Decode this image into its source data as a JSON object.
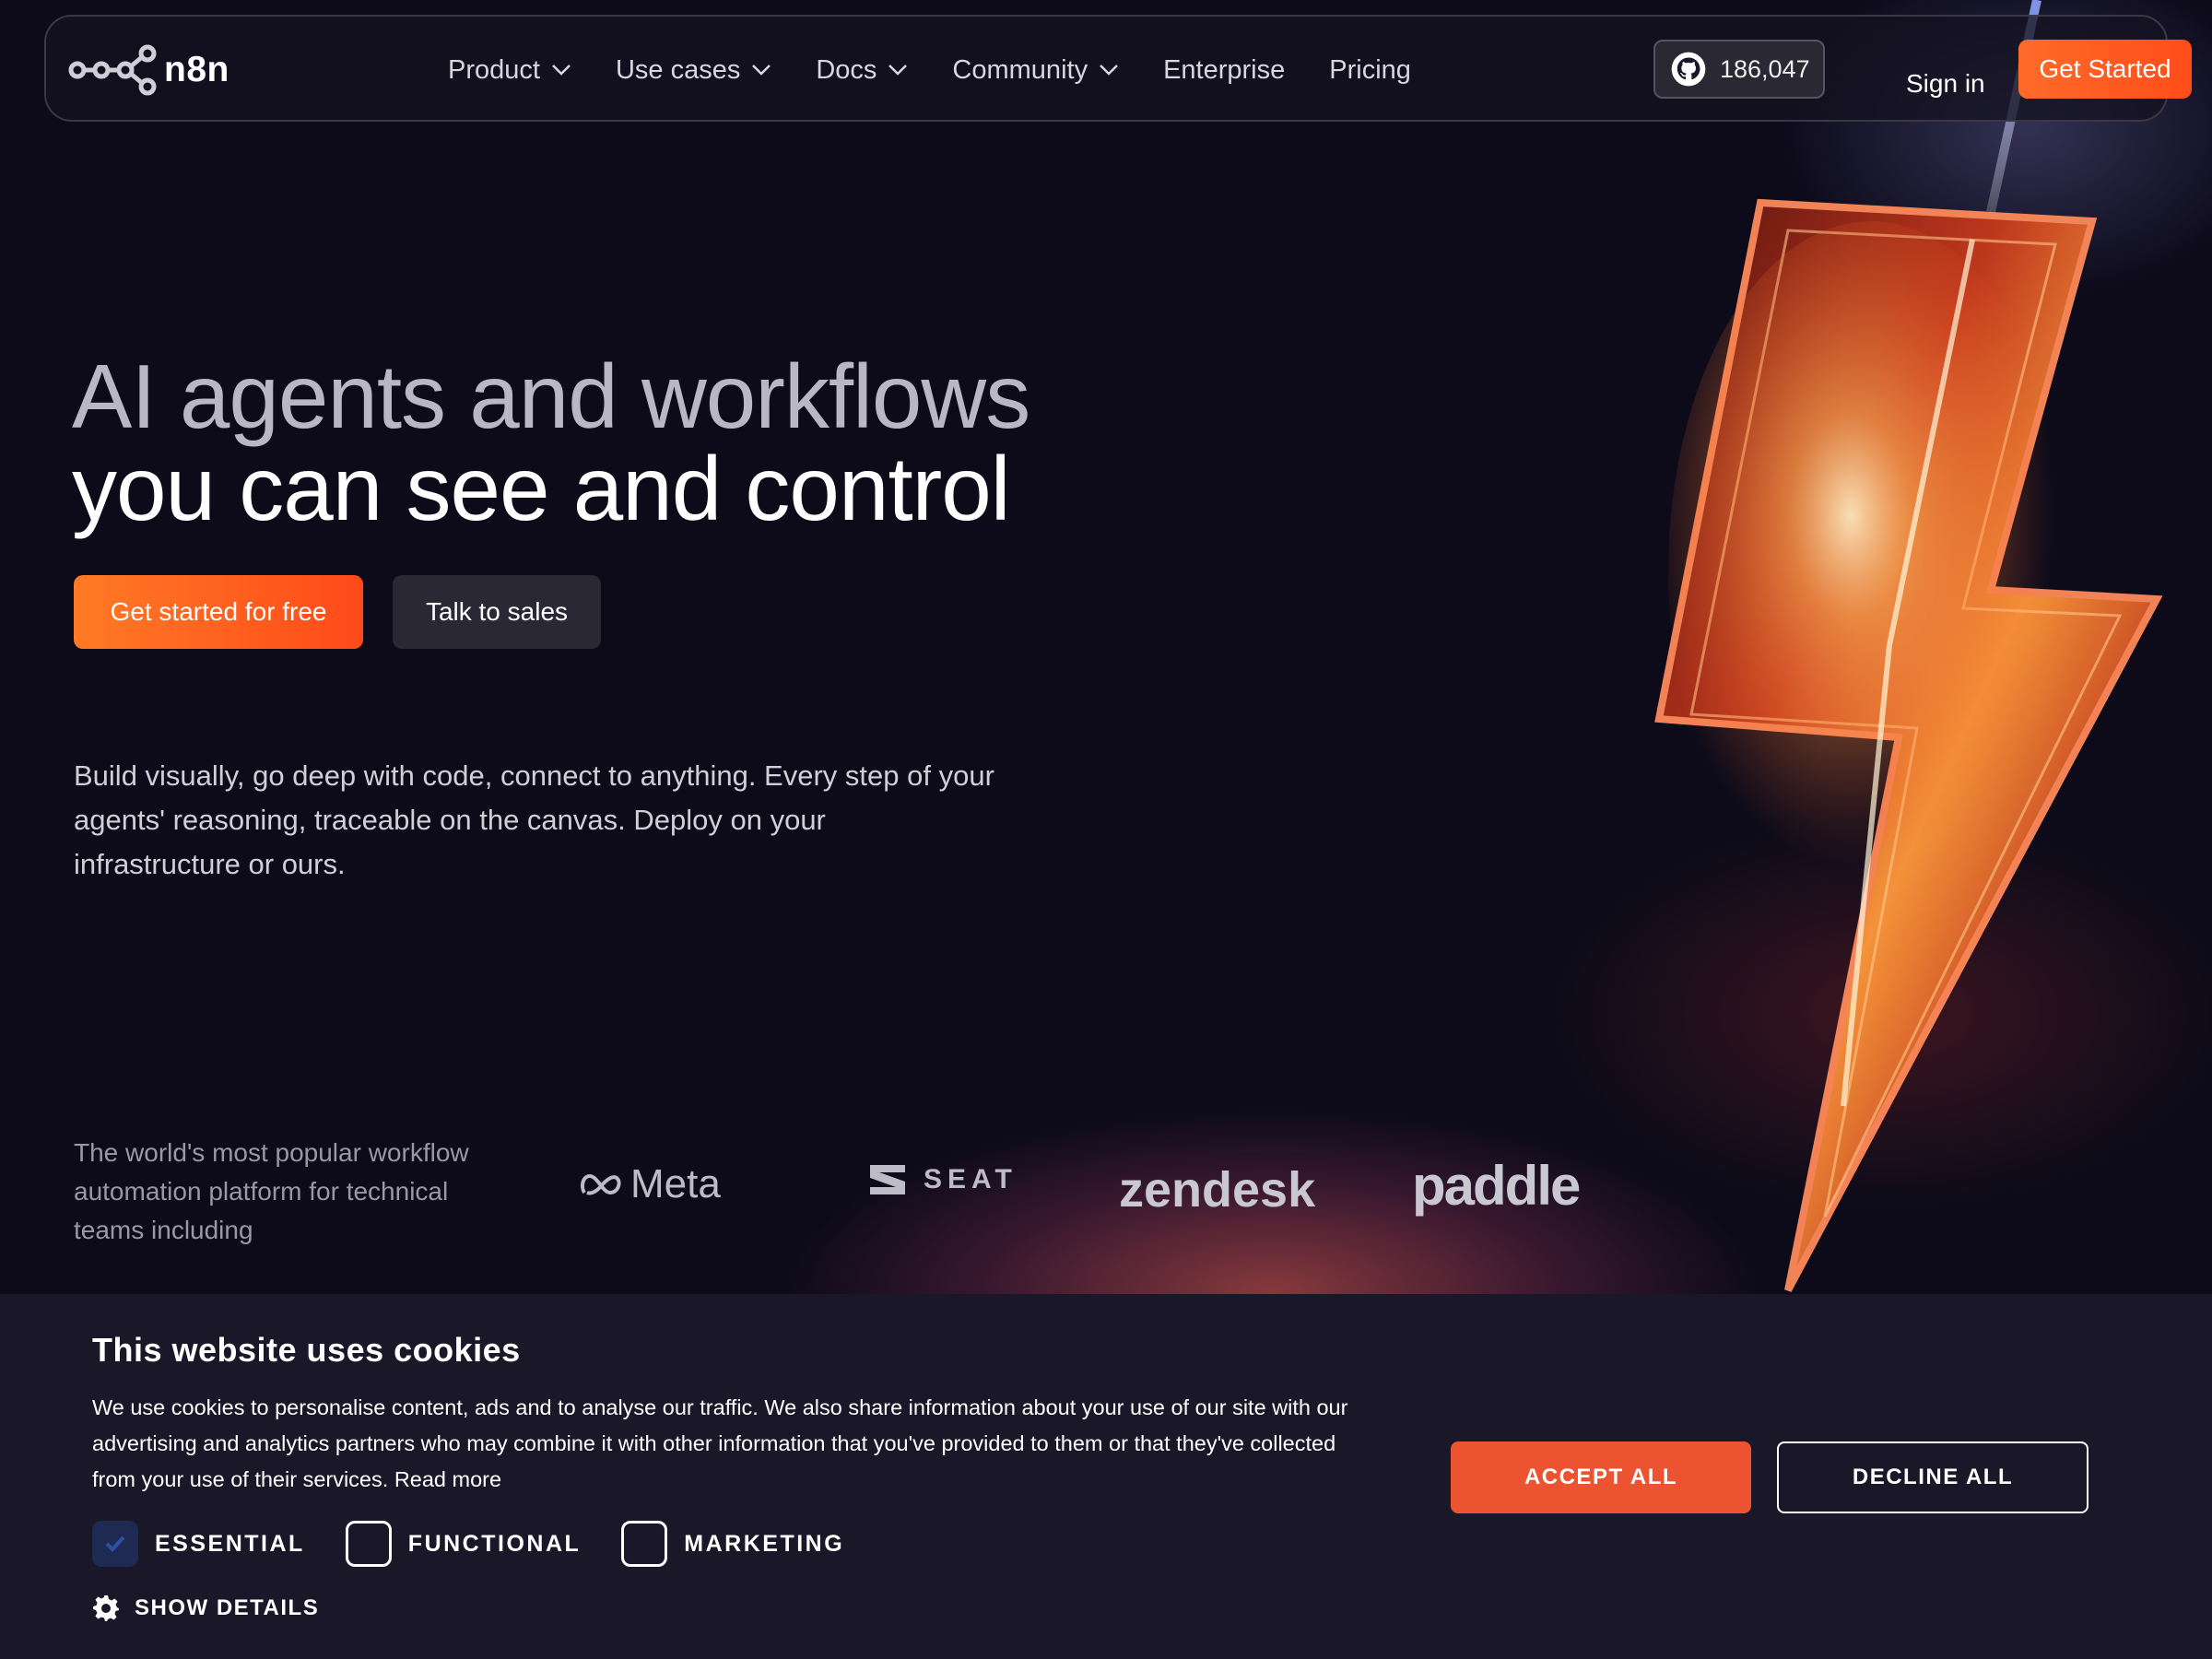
{
  "brand": {
    "name": "n8n",
    "accent": "#ff5a1f"
  },
  "nav": {
    "items": [
      {
        "label": "Product",
        "has_dropdown": true
      },
      {
        "label": "Use cases",
        "has_dropdown": true
      },
      {
        "label": "Docs",
        "has_dropdown": true
      },
      {
        "label": "Community",
        "has_dropdown": true
      },
      {
        "label": "Enterprise",
        "has_dropdown": false
      },
      {
        "label": "Pricing",
        "has_dropdown": false
      }
    ],
    "github_stars": "186,047",
    "github_icon": "github-icon",
    "sign_in": "Sign in",
    "cta": "Get Started"
  },
  "hero": {
    "headline_line1": "AI agents and workflows",
    "headline_line2": "you can see and control",
    "primary_button": "Get started for free",
    "secondary_button": "Talk to sales",
    "subtext": "Build visually, go deep with code, connect to anything. Every step of your agents' reasoning, traceable on the canvas. Deploy on your infrastructure or ours.",
    "tagline": "The world's most popular workflow automation platform for technical teams including",
    "logos": [
      "Meta",
      "SEAT",
      "zendesk",
      "paddle"
    ]
  },
  "cookie": {
    "title": "This website uses cookies",
    "body": "We use cookies to personalise content, ads and to analyse our traffic. We also share information about your use of our site with our advertising and analytics partners who may combine it with other information that you've provided to them or that they've collected from your use of their services.",
    "read_more": "Read more",
    "options": [
      {
        "label": "ESSENTIAL",
        "checked": true
      },
      {
        "label": "FUNCTIONAL",
        "checked": false
      },
      {
        "label": "MARKETING",
        "checked": false
      }
    ],
    "show_details": "SHOW DETAILS",
    "accept": "ACCEPT ALL",
    "decline": "DECLINE ALL",
    "accept_color": "#ec5330"
  }
}
